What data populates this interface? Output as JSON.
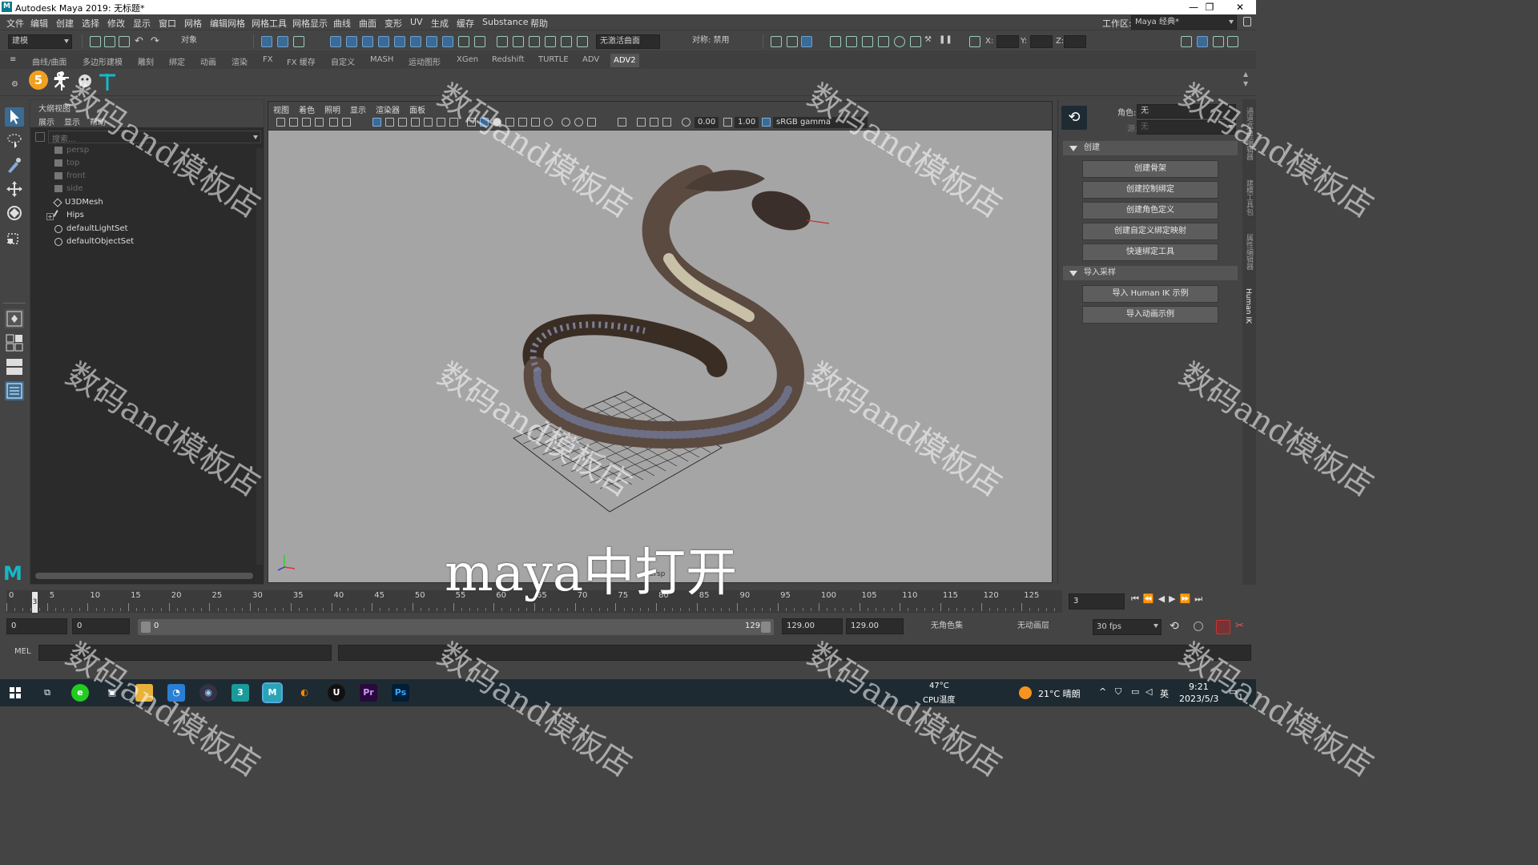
{
  "window": {
    "logo": "M",
    "title": "Autodesk Maya 2019: 无标题*"
  },
  "menubar": [
    "文件",
    "编辑",
    "创建",
    "选择",
    "修改",
    "显示",
    "窗口",
    "网格",
    "编辑网格",
    "网格工具",
    "网格显示",
    "曲线",
    "曲面",
    "变形",
    "UV",
    "生成",
    "缓存",
    "Substance",
    "帮助"
  ],
  "workspace": {
    "label": "工作区:",
    "value": "Maya 经典*"
  },
  "statusline": {
    "mode": "建模",
    "object_field": "对象",
    "live_surface": "无激活曲面",
    "symmetry": "对称: 禁用",
    "x_label": "X:",
    "y_label": "Y:",
    "z_label": "Z:"
  },
  "shelf_tabs": [
    "曲线/曲面",
    "多边形建模",
    "雕刻",
    "绑定",
    "动画",
    "渲染",
    "FX",
    "FX 缓存",
    "自定义",
    "MASH",
    "运动图形",
    "XGen",
    "Redshift",
    "TURTLE",
    "ADV",
    "ADV2"
  ],
  "shelf_active": "ADV2",
  "shelf_badge": "5",
  "outliner": {
    "title": "大纲视图",
    "menus": [
      "展示",
      "显示",
      "帮助"
    ],
    "search_placeholder": "搜索...",
    "items": [
      {
        "label": "persp",
        "dim": true
      },
      {
        "label": "top",
        "dim": true
      },
      {
        "label": "front",
        "dim": true
      },
      {
        "label": "side",
        "dim": true
      },
      {
        "label": "U3DMesh",
        "dim": false
      },
      {
        "label": "Hips",
        "dim": false
      },
      {
        "label": "defaultLightSet",
        "dim": false
      },
      {
        "label": "defaultObjectSet",
        "dim": false
      }
    ]
  },
  "viewport": {
    "menus": [
      "视图",
      "着色",
      "照明",
      "显示",
      "渲染器",
      "面板"
    ],
    "exposure": "0.00",
    "gamma": "1.00",
    "colorspace": "sRGB gamma",
    "camera_label": "persp"
  },
  "humanik": {
    "character_label": "角色:",
    "character_value": "无",
    "source_label": "源:",
    "source_value": "无",
    "create_section": "创建",
    "create_buttons": [
      "创建骨架",
      "创建控制绑定",
      "创建角色定义",
      "创建自定义绑定映射",
      "快速绑定工具"
    ],
    "import_section": "导入采样",
    "import_buttons": [
      "导入 Human IK 示例",
      "导入动画示例"
    ],
    "side_tabs": [
      "通道盒/层编辑器",
      "建模工具包",
      "属性编辑器",
      "Human IK"
    ]
  },
  "timeline": {
    "ticks": [
      "0",
      "5",
      "10",
      "15",
      "20",
      "25",
      "30",
      "35",
      "40",
      "45",
      "50",
      "55",
      "60",
      "65",
      "70",
      "75",
      "80",
      "85",
      "90",
      "95",
      "100",
      "105",
      "110",
      "115",
      "120",
      "125"
    ],
    "current_frame_marker": "3",
    "current_frame": "3",
    "current_frame_fraction": 0.024
  },
  "range": {
    "start": "0",
    "playback_start": "0",
    "slider_start": "0",
    "slider_end": "129",
    "playback_end": "129.00",
    "end": "129.00",
    "character_set": "无角色集",
    "anim_layer": "无动画层",
    "fps": "30 fps"
  },
  "cmdline": {
    "label": "MEL"
  },
  "taskbar": {
    "cpu_temp": "47°C",
    "cpu_label": "CPU温度",
    "weather": "21°C 晴朗",
    "ime": "英",
    "time": "9:21",
    "date": "2023/5/3",
    "notif": "1"
  },
  "overlay_caption": "maya中打开",
  "watermark_text": "数码and模板店",
  "colors": {
    "accent": "#3a6b95",
    "maya_teal": "#14b8c8",
    "viewport_bg": "#a5a5a5"
  }
}
